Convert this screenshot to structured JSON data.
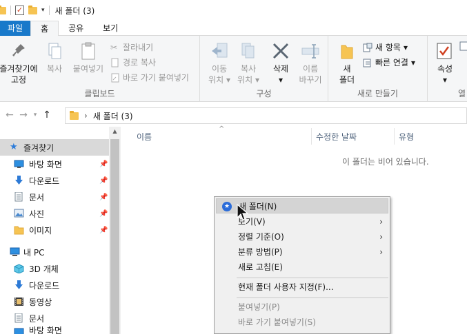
{
  "window": {
    "title": "새 폴더 (3)"
  },
  "tabs": [
    "파일",
    "홈",
    "공유",
    "보기"
  ],
  "ribbon": {
    "clipboard": {
      "pin_label_1": "즐겨찾기에",
      "pin_label_2": "고정",
      "copy_label": "복사",
      "paste_label": "붙여넣기",
      "cut_label": "잘라내기",
      "copy_path_label": "경로 복사",
      "paste_shortcut_label": "바로 가기 붙여넣기",
      "group_label": "클립보드"
    },
    "organize": {
      "move_label_1": "이동",
      "move_label_2": "위치",
      "copy_label_1": "복사",
      "copy_label_2": "위치",
      "delete_label": "삭제",
      "rename_label_1": "이름",
      "rename_label_2": "바꾸기",
      "group_label": "구성"
    },
    "new": {
      "new_folder_label_1": "새",
      "new_folder_label_2": "폴더",
      "new_item_label": "새 항목",
      "easy_access_label": "빠른 연결",
      "group_label": "새로 만들기"
    },
    "open": {
      "properties_label": "속성",
      "group_label_partial": "열"
    }
  },
  "address": {
    "path": "새 폴더 (3)",
    "separator": "›"
  },
  "navpane": {
    "quick_access": "즐겨찾기",
    "items": [
      {
        "label": "바탕 화면",
        "icon": "desktop-icon",
        "pinned": true
      },
      {
        "label": "다운로드",
        "icon": "download-icon",
        "pinned": true
      },
      {
        "label": "문서",
        "icon": "document-icon",
        "pinned": true
      },
      {
        "label": "사진",
        "icon": "pictures-icon",
        "pinned": true
      },
      {
        "label": "이미지",
        "icon": "folder-icon",
        "pinned": true
      }
    ],
    "this_pc": "내 PC",
    "pc_items": [
      {
        "label": "3D 개체",
        "icon": "3d-objects-icon"
      },
      {
        "label": "다운로드",
        "icon": "download-icon"
      },
      {
        "label": "동영상",
        "icon": "videos-icon"
      },
      {
        "label": "문서",
        "icon": "document-icon"
      },
      {
        "label": "바탕 화면",
        "icon": "desktop-icon"
      }
    ]
  },
  "columns": {
    "name": "이름",
    "modified": "수정한 날짜",
    "type": "유형"
  },
  "empty_message": "이 폴더는 비어 있습니다.",
  "context_menu": {
    "new_folder": "새 폴더(N)",
    "view": "보기(V)",
    "sort_by": "정렬 기준(O)",
    "group_by": "분류 방법(P)",
    "refresh": "새로 고침(E)",
    "customize": "현재 폴더 사용자 지정(F)...",
    "paste": "붙여넣기(P)",
    "paste_shortcut": "바로 가기 붙여넣기(S)",
    "submenu_glyph": "›"
  },
  "colors": {
    "file_tab": "#1979ca",
    "highlight": "#d4d4d4",
    "folder": "#f6c453"
  }
}
